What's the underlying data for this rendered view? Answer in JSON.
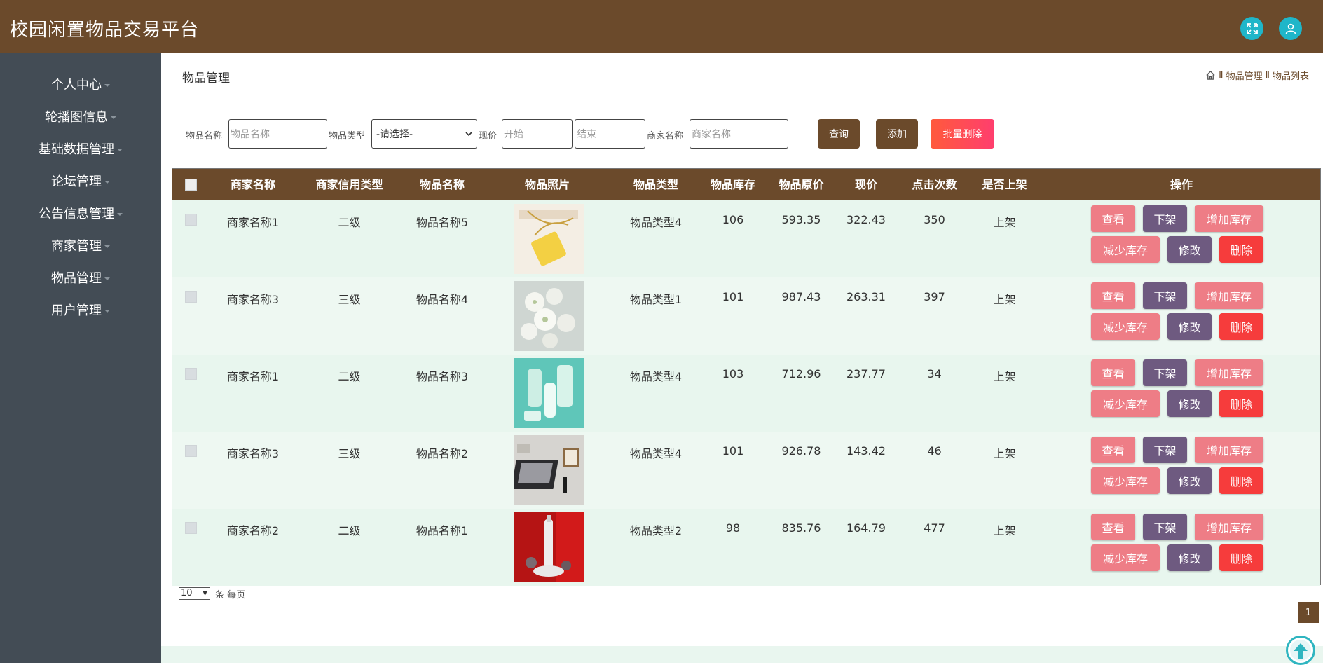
{
  "app": {
    "title": "校园闲置物品交易平台"
  },
  "header_icons": [
    "expand-icon",
    "user-icon"
  ],
  "sidebar": {
    "items": [
      {
        "label": "个人中心"
      },
      {
        "label": "轮播图信息"
      },
      {
        "label": "基础数据管理"
      },
      {
        "label": "论坛管理"
      },
      {
        "label": "公告信息管理"
      },
      {
        "label": "商家管理"
      },
      {
        "label": "物品管理"
      },
      {
        "label": "用户管理"
      }
    ]
  },
  "page": {
    "title": "物品管理",
    "breadcrumb": [
      "物品管理",
      "物品列表"
    ],
    "breadcrumb_sep": "Ⅱ"
  },
  "filters": {
    "name_label": "物品名称",
    "name_placeholder": "物品名称",
    "type_label": "物品类型",
    "type_selected": "-请选择-",
    "price_label": "现价",
    "price_start_placeholder": "开始",
    "price_end_placeholder": "结束",
    "merchant_label": "商家名称",
    "merchant_placeholder": "商家名称",
    "search_button": "查询",
    "add_button": "添加",
    "batch_delete_button": "批量删除"
  },
  "table": {
    "columns": [
      "商家名称",
      "商家信用类型",
      "物品名称",
      "物品照片",
      "物品类型",
      "物品库存",
      "物品原价",
      "现价",
      "点击次数",
      "是否上架",
      "操作"
    ],
    "actions": {
      "view": "查看",
      "off_shelf": "下架",
      "add_stock": "增加库存",
      "reduce_stock": "减少库存",
      "edit": "修改",
      "delete": "删除"
    },
    "rows": [
      {
        "merchant": "商家名称1",
        "credit": "二级",
        "name": "物品名称5",
        "photo": "necklace",
        "type": "物品类型4",
        "stock": "106",
        "original_price": "593.35",
        "price": "322.43",
        "clicks": "350",
        "on_shelf": "上架"
      },
      {
        "merchant": "商家名称3",
        "credit": "三级",
        "name": "物品名称4",
        "photo": "flowers",
        "type": "物品类型1",
        "stock": "101",
        "original_price": "987.43",
        "price": "263.31",
        "clicks": "397",
        "on_shelf": "上架"
      },
      {
        "merchant": "商家名称1",
        "credit": "二级",
        "name": "物品名称3",
        "photo": "cosmetics",
        "type": "物品类型4",
        "stock": "103",
        "original_price": "712.96",
        "price": "237.77",
        "clicks": "34",
        "on_shelf": "上架"
      },
      {
        "merchant": "商家名称3",
        "credit": "三级",
        "name": "物品名称2",
        "photo": "electronics",
        "type": "物品类型4",
        "stock": "101",
        "original_price": "926.78",
        "price": "143.42",
        "clicks": "46",
        "on_shelf": "上架"
      },
      {
        "merchant": "商家名称2",
        "credit": "二级",
        "name": "物品名称1",
        "photo": "serum",
        "type": "物品类型2",
        "stock": "98",
        "original_price": "835.76",
        "price": "164.79",
        "clicks": "477",
        "on_shelf": "上架"
      }
    ]
  },
  "pagination": {
    "page_size": "10",
    "per_page_text": "条 每页",
    "current_page": "1"
  },
  "colors": {
    "brand": "#6b4a2b",
    "sidebar": "#434c55",
    "accent": "#1fb6c9",
    "pink": "#ee7d86",
    "purple": "#6e5a80",
    "red": "#f63c3c"
  }
}
